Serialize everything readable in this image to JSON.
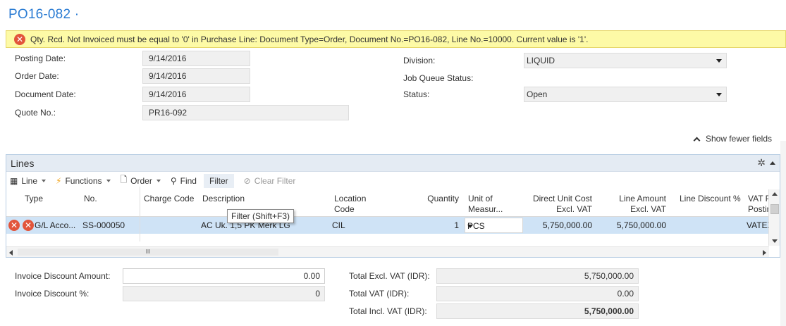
{
  "page": {
    "title": "PO16-082 ·"
  },
  "error": {
    "message": "Qty. Rcd. Not Invoiced must be equal to '0'  in Purchase Line: Document Type=Order, Document No.=PO16-082, Line No.=10000. Current value is '1'."
  },
  "header": {
    "posting_date_label": "Posting Date:",
    "posting_date": "9/14/2016",
    "order_date_label": "Order Date:",
    "order_date": "9/14/2016",
    "document_date_label": "Document Date:",
    "document_date": "9/14/2016",
    "quote_no_label": "Quote No.:",
    "quote_no": "PR16-092",
    "division_label": "Division:",
    "division": "LIQUID",
    "job_queue_status_label": "Job Queue Status:",
    "status_label": "Status:",
    "status": "Open",
    "show_fewer_label": "Show fewer fields"
  },
  "lines": {
    "title": "Lines",
    "toolbar": {
      "line": "Line",
      "functions": "Functions",
      "order": "Order",
      "find": "Find",
      "filter": "Filter",
      "clear_filter": "Clear Filter"
    },
    "tooltip": "Filter (Shift+F3)",
    "columns": {
      "type": "Type",
      "no": "No.",
      "charge_code": "Charge Code",
      "description": "Description",
      "location_code": [
        "Location",
        "Code"
      ],
      "quantity": "Quantity",
      "unit_of_measure": [
        "Unit of",
        "Measur..."
      ],
      "direct_unit_cost": [
        "Direct Unit Cost",
        "Excl. VAT"
      ],
      "line_amount": [
        "Line Amount",
        "Excl. VAT"
      ],
      "line_discount": "Line Discount %",
      "vat_posting": [
        "VAT P",
        "Postin"
      ]
    },
    "row": {
      "type": "G/L Acco...",
      "no": "SS-000050",
      "charge_code": "",
      "description": "AC Uk. 1,5 PK Merk LG",
      "location_code": "CIL",
      "quantity": "1",
      "unit_of_measure": "PCS",
      "direct_unit_cost": "5,750,000.00",
      "line_amount": "5,750,000.00",
      "line_discount": "",
      "vat_posting": "VATEX"
    },
    "hscroll_grip": "III"
  },
  "totals": {
    "invoice_discount_amount_label": "Invoice Discount Amount:",
    "invoice_discount_amount": "0.00",
    "invoice_discount_pct_label": "Invoice Discount %:",
    "invoice_discount_pct": "0",
    "total_excl_vat_label": "Total Excl. VAT (IDR):",
    "total_excl_vat": "5,750,000.00",
    "total_vat_label": "Total VAT (IDR):",
    "total_vat": "0.00",
    "total_incl_vat_label": "Total Incl. VAT (IDR):",
    "total_incl_vat": "5,750,000.00"
  },
  "colors": {
    "title": "#2b7cd3",
    "error_bg": "#fdfaa6",
    "error_icon": "#e2553b",
    "selected_row": "#cfe3f6",
    "lines_header": "#e4ebf3"
  }
}
